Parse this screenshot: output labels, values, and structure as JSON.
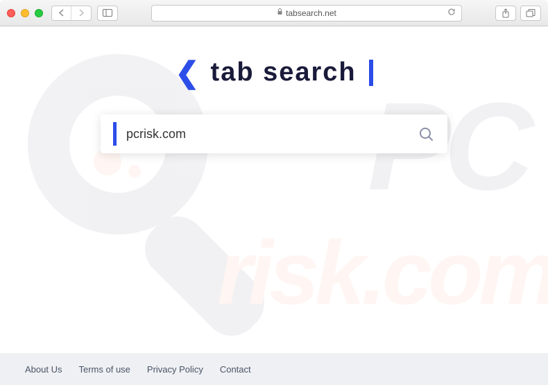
{
  "browser": {
    "url_display": "tabsearch.net"
  },
  "logo": {
    "text": "tab search"
  },
  "search": {
    "value": "pcrisk.com",
    "placeholder": ""
  },
  "footer": {
    "links": [
      "About Us",
      "Terms of use",
      "Privacy Policy",
      "Contact"
    ]
  },
  "watermark": {
    "text_top": "PC",
    "text_bottom": "risk.com"
  }
}
